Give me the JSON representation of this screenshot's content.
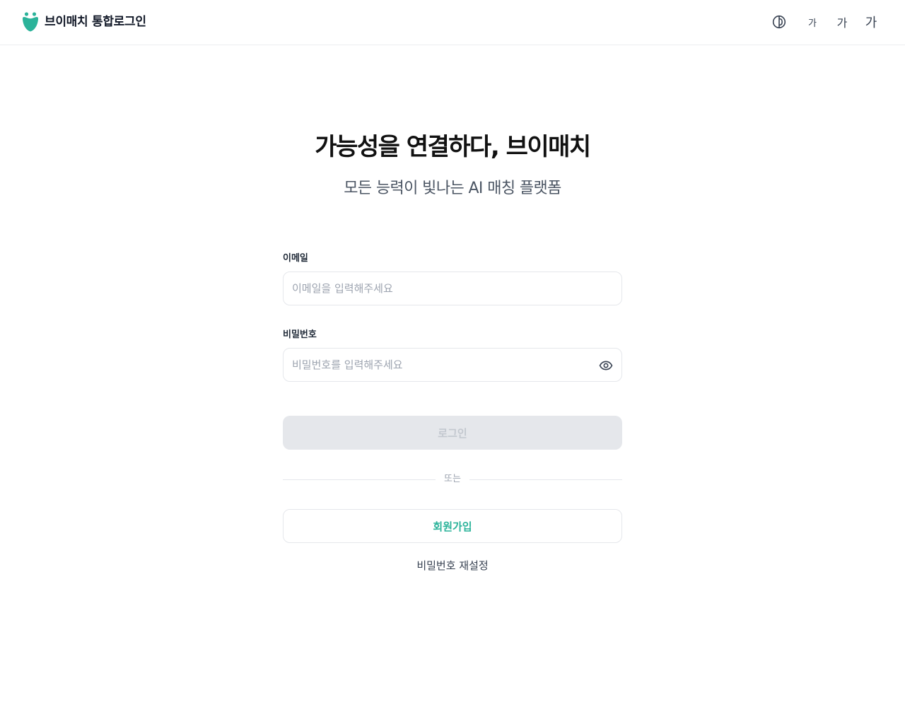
{
  "header": {
    "brand_name": "브이매치 통합로그인",
    "contrast_icon": "contrast-icon",
    "font_sizes": [
      "가",
      "가",
      "가"
    ]
  },
  "hero": {
    "title": "가능성을 연결하다, 브이매치",
    "subtitle": "모든 능력이 빛나는 AI 매칭 플랫폼"
  },
  "form": {
    "email_label": "이메일",
    "email_placeholder": "이메일을 입력해주세요",
    "email_value": "",
    "password_label": "비밀번호",
    "password_placeholder": "비밀번호를 입력해주세요",
    "password_value": "",
    "password_toggle_icon": "eye-icon",
    "login_label": "로그인",
    "divider_text": "또는",
    "signup_label": "회원가입",
    "reset_label": "비밀번호 재설정"
  },
  "colors": {
    "brand": "#2bb39a",
    "disabled_bg": "#e5e7eb",
    "disabled_text": "#c3c8cf",
    "border": "#e5e7eb"
  }
}
